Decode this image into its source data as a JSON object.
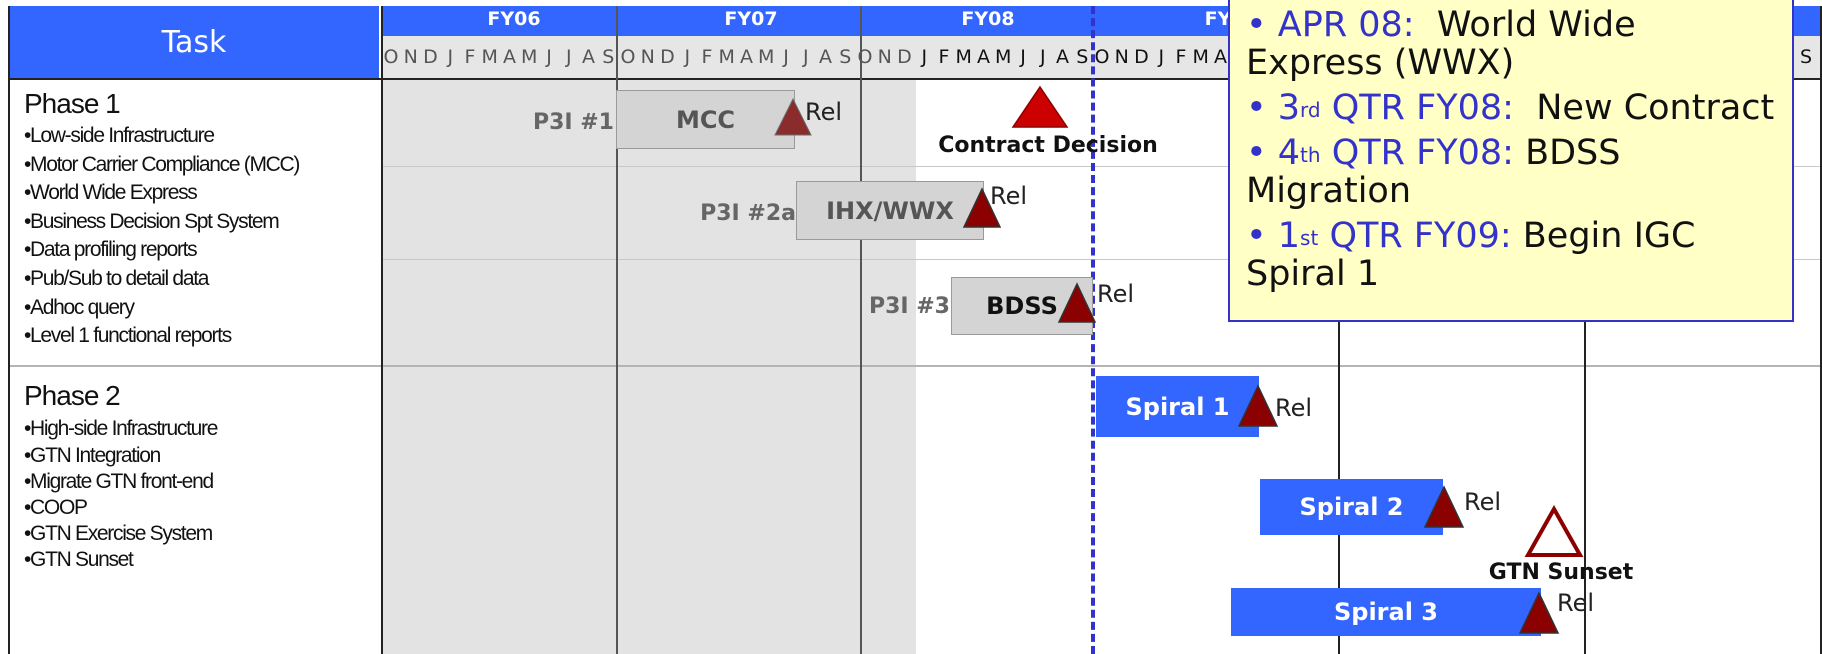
{
  "header": {
    "task_label": "Task",
    "fiscal_years": [
      "FY06",
      "FY07",
      "FY08",
      "FY"
    ],
    "months": [
      "O",
      "N",
      "D",
      "J",
      "F",
      "M",
      "A",
      "M",
      "J",
      "J",
      "A",
      "S",
      "O",
      "N",
      "D",
      "J",
      "F",
      "M",
      "A",
      "M",
      "J",
      "J",
      "A",
      "S",
      "O",
      "N",
      "D",
      "J",
      "F",
      "M",
      "A",
      "M",
      "J",
      "J",
      "A",
      "S",
      "O",
      "N",
      "D",
      "J",
      "F",
      "M",
      "A"
    ],
    "right_edge_month": "S"
  },
  "phases": [
    {
      "title": "Phase 1",
      "items": [
        "•Low-side Infrastructure",
        "•Motor Carrier Compliance (MCC)",
        "•World Wide Express",
        "•Business Decision Spt System",
        "•Data profiling reports",
        "•Pub/Sub to detail data",
        "•Adhoc query",
        "•Level 1 functional reports"
      ]
    },
    {
      "title": "Phase 2",
      "items": [
        "•High-side Infrastructure",
        "•GTN Integration",
        "•Migrate GTN front-end",
        "•COOP",
        "•GTN Exercise System",
        "•GTN Sunset"
      ]
    }
  ],
  "bars": [
    {
      "prefix": "P3I #1",
      "label": "MCC",
      "rel": "Rel",
      "style": "grey"
    },
    {
      "prefix": "P3I #2a",
      "label": "IHX/WWX",
      "rel": "Rel",
      "style": "grey"
    },
    {
      "prefix": "P3I #3",
      "label": "BDSS",
      "rel": "Rel",
      "style": "grey"
    },
    {
      "prefix": "",
      "label": "Spiral 1",
      "rel": "Rel",
      "style": "blue"
    },
    {
      "prefix": "",
      "label": "Spiral 2",
      "rel": "Rel",
      "style": "blue"
    },
    {
      "prefix": "",
      "label": "Spiral 3",
      "rel": "Rel",
      "style": "blue"
    }
  ],
  "milestones": [
    {
      "label": "Contract Decision"
    },
    {
      "label": "GTN Sunset"
    }
  ],
  "callout": [
    {
      "pre": "• APR 08:",
      "sup": "",
      "post": "",
      "rest": "World Wide Express (WWX)"
    },
    {
      "pre": "• 3",
      "sup": "rd",
      "post": " QTR FY08:",
      "rest": "New Contract"
    },
    {
      "pre": "• 4",
      "sup": "th",
      "post": " QTR FY08:",
      "rest": "BDSS Migration"
    },
    {
      "pre": "• 1",
      "sup": "st",
      "post": " QTR FY09:",
      "rest": "Begin IGC Spiral 1"
    }
  ],
  "colors": {
    "header_blue": "#3366ff",
    "milestone_red": "#8b0000",
    "callout_fill": "#ffffc6",
    "callout_accent": "#3333cc",
    "current_date_line": "#3333cc"
  }
}
